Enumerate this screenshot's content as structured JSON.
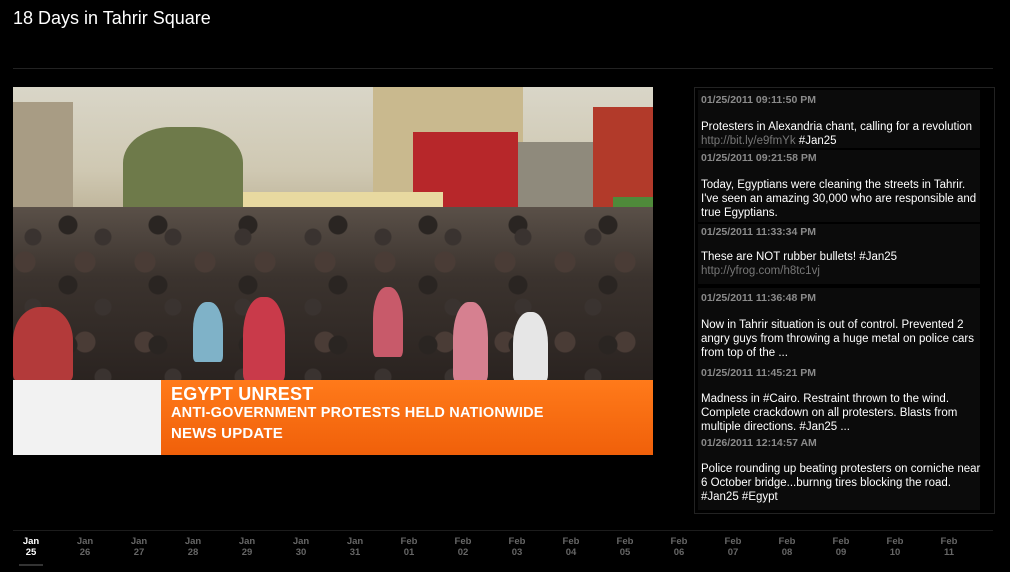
{
  "page": {
    "title": "18 Days in Tahrir Square"
  },
  "video": {
    "ticker_line1": "EGYPT UNREST",
    "ticker_line2": "ANTI-GOVERNMENT PROTESTS HELD NATIONWIDE",
    "ticker_line3": "NEWS UPDATE"
  },
  "feed": {
    "tweets": [
      {
        "time": "01/25/2011 09:11:50 PM",
        "text": "Protesters in Alexandria chant, calling for a revolution ",
        "link": "http://bit.ly/e9fmYk",
        "tail": " #Jan25"
      },
      {
        "time": "01/25/2011 09:21:58 PM",
        "text": "Today, Egyptians were cleaning the streets in Tahrir. I've seen an amazing 30,000 who are responsible and true Egyptians.",
        "link": "",
        "tail": ""
      },
      {
        "time": "01/25/2011 11:33:34 PM",
        "text": "These are NOT rubber bullets! #Jan25",
        "link": "http://yfrog.com/h8tc1vj",
        "tail": ""
      },
      {
        "time": "01/25/2011 11:36:48 PM",
        "text": "Now in Tahrir situation is out of control. Prevented 2 angry guys from throwing a huge metal on police cars from top of the ...",
        "link": "",
        "tail": ""
      },
      {
        "time": "01/25/2011 11:45:21 PM",
        "text": "Madness in #Cairo. Restraint thrown to the wind. Complete crackdown on all protesters. Blasts from multiple directions. #Jan25 ...",
        "link": "",
        "tail": ""
      },
      {
        "time": "01/26/2011 12:14:57 AM",
        "text": "Police rounding up beating protesters on corniche near 6 October bridge...burnng tires blocking the road. #Jan25 #Egypt",
        "link": "",
        "tail": ""
      }
    ]
  },
  "timeline": {
    "active_index": 0,
    "days": [
      {
        "month": "Jan",
        "day": "25"
      },
      {
        "month": "Jan",
        "day": "26"
      },
      {
        "month": "Jan",
        "day": "27"
      },
      {
        "month": "Jan",
        "day": "28"
      },
      {
        "month": "Jan",
        "day": "29"
      },
      {
        "month": "Jan",
        "day": "30"
      },
      {
        "month": "Jan",
        "day": "31"
      },
      {
        "month": "Feb",
        "day": "01"
      },
      {
        "month": "Feb",
        "day": "02"
      },
      {
        "month": "Feb",
        "day": "03"
      },
      {
        "month": "Feb",
        "day": "04"
      },
      {
        "month": "Feb",
        "day": "05"
      },
      {
        "month": "Feb",
        "day": "06"
      },
      {
        "month": "Feb",
        "day": "07"
      },
      {
        "month": "Feb",
        "day": "08"
      },
      {
        "month": "Feb",
        "day": "09"
      },
      {
        "month": "Feb",
        "day": "10"
      },
      {
        "month": "Feb",
        "day": "11"
      }
    ]
  }
}
